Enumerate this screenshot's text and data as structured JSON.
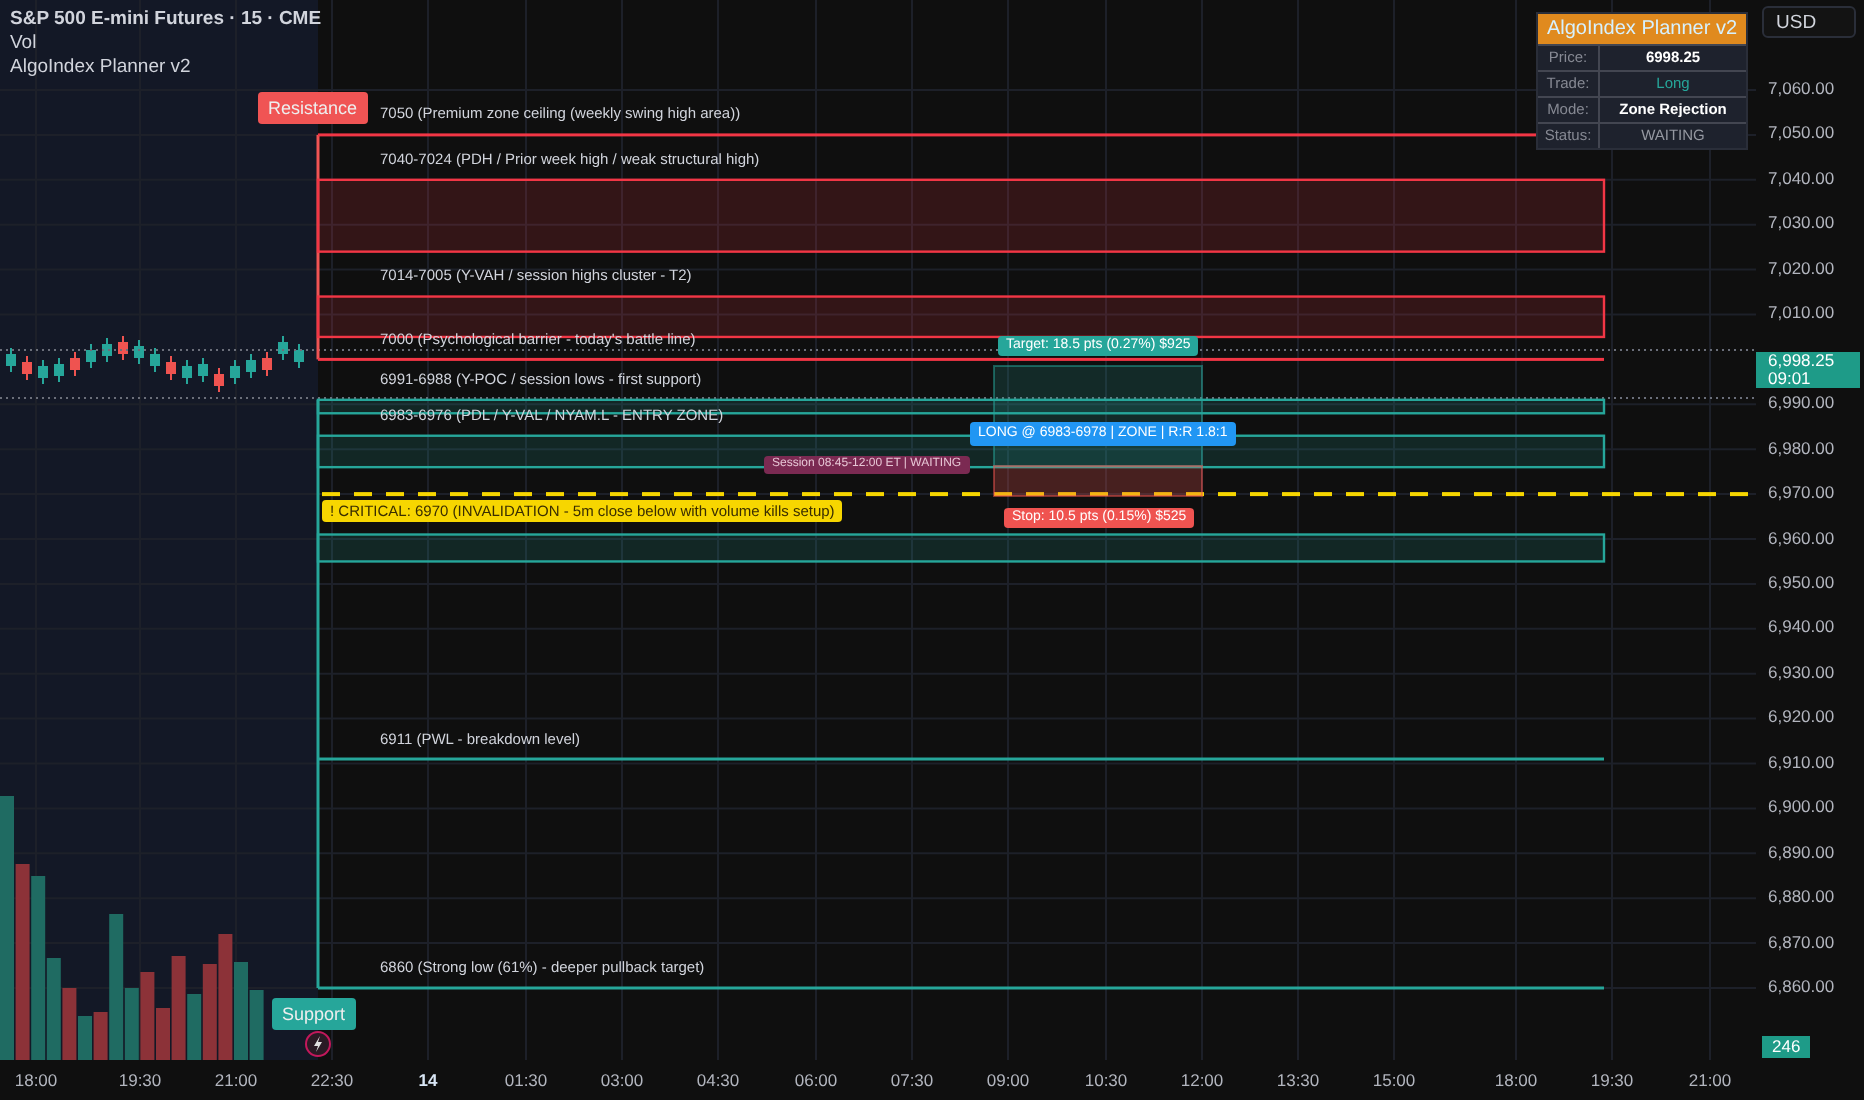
{
  "legend": {
    "symbol": "S&P 500 E-mini Futures · 15 · CME",
    "lines": [
      "Vol",
      "AlgoIndex Planner v2"
    ]
  },
  "currency_button": "USD",
  "planner_panel": {
    "title": "AlgoIndex Planner v2",
    "rows": [
      {
        "label": "Price:",
        "value": "6998.25",
        "kind": "plain"
      },
      {
        "label": "Trade:",
        "value": "Long",
        "kind": "positive"
      },
      {
        "label": "Mode:",
        "value": "Zone Rejection",
        "kind": "plain"
      },
      {
        "label": "Status:",
        "value": "WAITING",
        "kind": "muted"
      }
    ]
  },
  "zone_tags": [
    {
      "label": "Resistance",
      "color": "#f05454"
    },
    {
      "label": "Support",
      "color": "#26a69a"
    }
  ],
  "levels": [
    {
      "kind": "line",
      "color": "#f23645",
      "label": "7050 (Premium zone ceiling (weekly swing high area))"
    },
    {
      "kind": "zone",
      "color": "#f23645",
      "label": "7040-7024 (PDH / Prior week high / weak structural high)"
    },
    {
      "kind": "zone",
      "color": "#f23645",
      "label": "7014-7005 (Y-VAH / session highs cluster - T2)"
    },
    {
      "kind": "line",
      "color": "#f23645",
      "label": "7000 (Psychological barrier - today's battle line)"
    },
    {
      "kind": "zone",
      "color": "#26a69a",
      "label": "6991-6988 (Y-POC / session lows - first support)"
    },
    {
      "kind": "zone",
      "color": "#26a69a",
      "label": "6983-6976 (PDL / Y-VAL / NYAM.L - ENTRY ZONE)"
    },
    {
      "kind": "critical",
      "color": "#f7d600",
      "label": "!  CRITICAL: 6970 (INVALIDATION - 5m close below with volume kills setup)"
    },
    {
      "kind": "zone",
      "color": "#26a69a"
    },
    {
      "kind": "line",
      "color": "#26a69a",
      "label": "6911 (PWL - breakdown level)"
    },
    {
      "kind": "line",
      "color": "#26a69a",
      "label": "6860 (Strong low (61%) - deeper pullback target)"
    }
  ],
  "trade": {
    "target": "Target: 18.5 pts (0.27%) $925",
    "entry": "LONG @ 6983-6978 | ZONE | R:R 1.8:1",
    "stop": "Stop: 10.5 pts (0.15%) $525",
    "session": "Session 08:45-12:00 ET | WAITING"
  },
  "price_axis": {
    "ticks": [
      "7,060.00",
      "7,050.00",
      "7,040.00",
      "7,030.00",
      "7,020.00",
      "7,010.00",
      "6,990.00",
      "6,980.00",
      "6,970.00",
      "6,960.00",
      "6,950.00",
      "6,940.00",
      "6,930.00",
      "6,920.00",
      "6,910.00",
      "6,900.00",
      "6,890.00",
      "6,880.00",
      "6,870.00",
      "6,860.00"
    ],
    "last_price": "6,998.25",
    "countdown": "09:01",
    "volume": "246"
  },
  "time_axis": [
    {
      "label": "18:00",
      "kind": "time"
    },
    {
      "label": "19:30",
      "kind": "time"
    },
    {
      "label": "21:00",
      "kind": "time"
    },
    {
      "label": "22:30",
      "kind": "time"
    },
    {
      "label": "14",
      "kind": "day"
    },
    {
      "label": "01:30",
      "kind": "time"
    },
    {
      "label": "03:00",
      "kind": "time"
    },
    {
      "label": "04:30",
      "kind": "time"
    },
    {
      "label": "06:00",
      "kind": "time"
    },
    {
      "label": "07:30",
      "kind": "time"
    },
    {
      "label": "09:00",
      "kind": "time"
    },
    {
      "label": "10:30",
      "kind": "time"
    },
    {
      "label": "12:00",
      "kind": "time"
    },
    {
      "label": "13:30",
      "kind": "time"
    },
    {
      "label": "15:00",
      "kind": "time"
    },
    {
      "label": "18:00",
      "kind": "time"
    },
    {
      "label": "19:30",
      "kind": "time"
    },
    {
      "label": "21:00",
      "kind": "time"
    }
  ]
}
